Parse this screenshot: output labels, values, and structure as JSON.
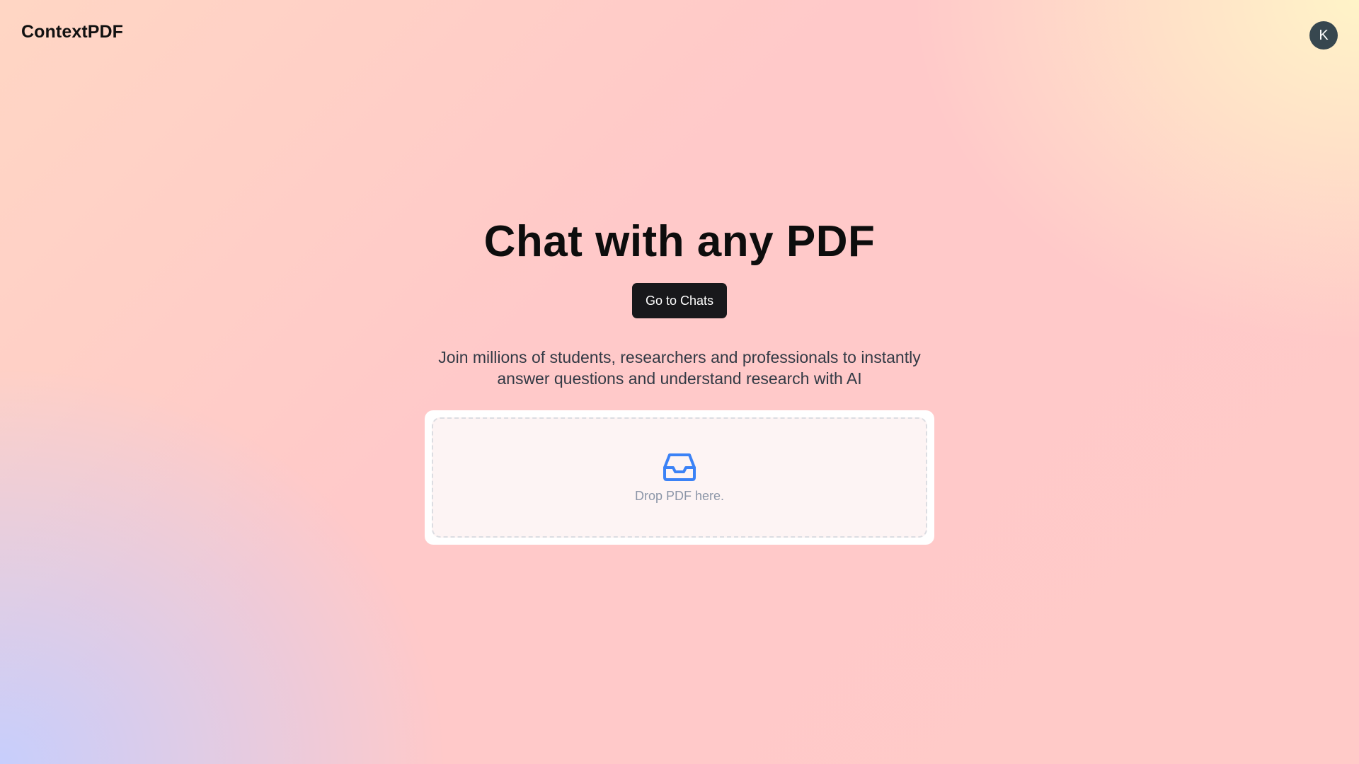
{
  "header": {
    "logo_text": "ContextPDF",
    "avatar_initial": "K"
  },
  "hero": {
    "title": "Chat with any PDF",
    "cta_label": "Go to Chats",
    "subtitle": "Join millions of students, researchers and professionals to instantly answer questions and understand research with AI"
  },
  "upload": {
    "icon": "inbox-icon",
    "label": "Drop PDF here."
  },
  "colors": {
    "accent_icon": "#3b82f6",
    "button_bg": "#18181b",
    "avatar_bg": "#37474f"
  }
}
